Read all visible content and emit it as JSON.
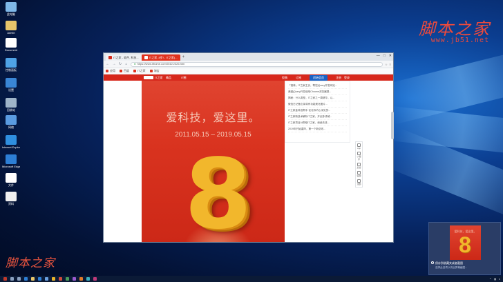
{
  "desktop": {
    "icons": [
      {
        "label": "此电脑",
        "icon": "computer-icon",
        "color": "#7fb8e8"
      },
      {
        "label": "Admin",
        "icon": "user-folder-icon",
        "color": "#e8c56a"
      },
      {
        "label": "Document",
        "icon": "document-icon",
        "color": "#ffffff"
      },
      {
        "label": "控制面板",
        "icon": "control-panel-icon",
        "color": "#4fa3e6"
      },
      {
        "label": "设置",
        "icon": "settings-icon",
        "color": "#3a86d6"
      },
      {
        "label": "回收站",
        "icon": "recycle-bin-icon",
        "color": "#9fb4c9"
      },
      {
        "label": "网络",
        "icon": "network-icon",
        "color": "#5a9be0"
      },
      {
        "label": "Internet Explorer",
        "icon": "ie-icon",
        "color": "#2f8fe0"
      },
      {
        "label": "Microsoft Edge",
        "icon": "edge-icon",
        "color": "#2d7fd6"
      },
      {
        "label": "文件",
        "icon": "file-icon",
        "color": "#ffffff"
      },
      {
        "label": "资料",
        "icon": "file-icon",
        "color": "#f0f0f0"
      }
    ]
  },
  "watermark": {
    "top": "脚本之家",
    "top_url": "www.jb51.net",
    "bottom": "脚本之家",
    "color": "#ef4a3b"
  },
  "browser": {
    "tabs": [
      {
        "label": "IT之家 - 软件, 科技...",
        "active": false
      },
      {
        "label": "IT之家, 8岁! - IT之家(...",
        "active": true
      }
    ],
    "newtab": "+",
    "window_controls": [
      "—",
      "□",
      "✕"
    ],
    "url": "https://www.ithome.com/0/421/326.htm",
    "bookmarks": [
      "应用",
      "百度",
      "IT之家",
      "淘宝"
    ],
    "site_nav": {
      "left": [
        "IT之家",
        "精品",
        "IT圈"
      ],
      "right": [
        "投稿",
        "订阅",
        "初始会员",
        "注册",
        "登录"
      ]
    },
    "poster": {
      "slogan": "爱科技，爱这里。",
      "dates": "2011.05.15 – 2019.05.15",
      "big_number": "8"
    },
    "sidebar_rows": [
      "「推荐」IT之家主页，帮您jQuery开发网站...",
      "美团jQuery开发使用Chrome浏览器提...",
      "揭秘：什么类型，IT之家之一周精华，以...",
      "微信日记备忘录将有功能美化图片...",
      "IT之家金科技帮手·优化你内心深处的...",
      "IT之家新技术解析IT之家，开创多领域...",
      "IT之家项目分帮助IT之家，继续先进...",
      "2019年开始重阵，第一个新总线..."
    ],
    "float_buttons": [
      {
        "label": "App",
        "icon": "app-icon"
      },
      {
        "label": "小程序",
        "icon": "miniapp-icon"
      },
      {
        "label": "反馈",
        "icon": "feedback-icon"
      },
      {
        "label": "客服",
        "icon": "service-icon"
      },
      {
        "label": "顶部",
        "icon": "top-icon"
      }
    ]
  },
  "toast": {
    "thumb_slogan": "爱科技，爱这里。",
    "thumb_number": "8",
    "title": "保存到收藏夹或者截图",
    "subtitle": "选择此选项以将此屏幕截图..."
  },
  "taskbar": {
    "icons": [
      {
        "icon": "start-icon",
        "color": "#c0392b"
      },
      {
        "icon": "search-icon",
        "color": "#8aa0c0"
      },
      {
        "icon": "task-view-icon",
        "color": "#8aa0c0"
      },
      {
        "icon": "edge-icon",
        "color": "#2d7fd6"
      },
      {
        "icon": "explorer-icon",
        "color": "#e8c56a"
      },
      {
        "icon": "store-icon",
        "color": "#2d7fd6"
      },
      {
        "icon": "mail-icon",
        "color": "#6aa0e0"
      },
      {
        "icon": "chrome-icon",
        "color": "#e8b32a"
      },
      {
        "icon": "media-icon",
        "color": "#d04a3a"
      },
      {
        "icon": "app-icon",
        "color": "#4a9a5a"
      },
      {
        "icon": "app-icon",
        "color": "#9a5ad0"
      },
      {
        "icon": "app-icon",
        "color": "#e07a2a"
      },
      {
        "icon": "app-icon",
        "color": "#3ab0c0"
      },
      {
        "icon": "app-icon",
        "color": "#c03a7a"
      }
    ]
  }
}
